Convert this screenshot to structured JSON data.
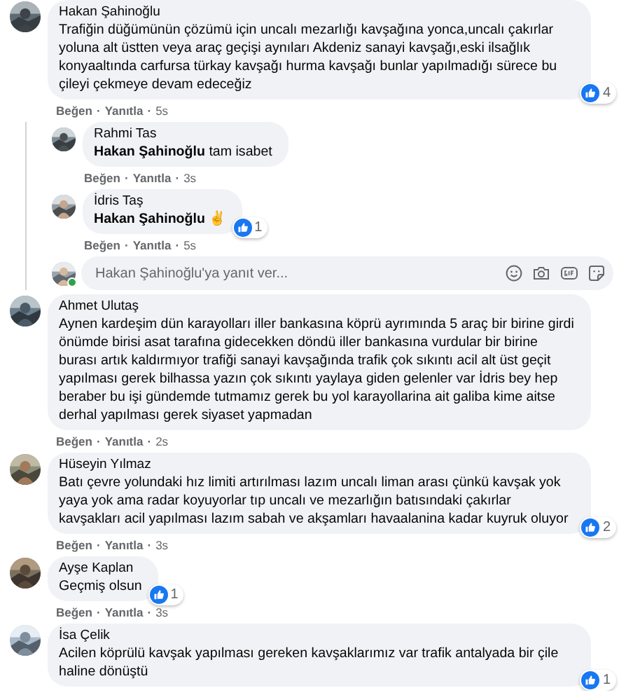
{
  "separator": "·",
  "comments": [
    {
      "author": "Hakan Şahinoğlu",
      "text": "Trafiğin düğümünün çözümü için uncalı mezarlığı kavşağına yonca,uncalı çakırlar yoluna alt üstten veya araç geçişi aynıları Akdeniz sanayi kavşağı,eski ilsağlık konyaaltında carfursa türkay kavşağı hurma kavşağı bunlar yapılmadığı sürece bu çileyi çekmeye devam edeceğiz",
      "likes": "4",
      "like_action": "Beğen",
      "reply_action": "Yanıtla",
      "time": "5s",
      "replies": [
        {
          "author": "Rahmi Tas",
          "text": "**Hakan Şahinoğlu** tam isabet",
          "like_action": "Beğen",
          "reply_action": "Yanıtla",
          "time": "3s"
        },
        {
          "author": "İdris Taş",
          "text": "**Hakan Şahinoğlu** ✌",
          "likes": "1",
          "like_action": "Beğen",
          "reply_action": "Yanıtla",
          "time": "5s"
        }
      ],
      "reply_box": {
        "placeholder": "Hakan Şahinoğlu'ya yanıt ver...",
        "online": true
      }
    },
    {
      "author": "Ahmet Ulutaş",
      "text": "Aynen kardeşim dün karayolları iller bankasına köprü ayrımında 5 araç bir birine girdi önümde birisi asat tarafına gidecekken döndü iller bankasına vurdular bir birine burası artık kaldırmıyor trafiği sanayi kavşağında trafik çok sıkıntı acil alt üst geçit yapılması gerek bilhassa yazın çok sıkıntı yaylaya giden gelenler var İdris bey hep beraber bu işi gündemde tutmamız gerek bu yol karayollarina ait galiba kime aitse derhal yapılması gerek siyaset yapmadan",
      "like_action": "Beğen",
      "reply_action": "Yanıtla",
      "time": "2s"
    },
    {
      "author": "Hüseyin Yılmaz",
      "text": "Batı çevre yolundaki hız limiti artırılması lazım uncalı liman arası çünkü kavşak yok yaya yok ama radar koyuyorlar tıp uncalı ve mezarlığın batısındaki çakırlar kavşakları acil yapılması lazım sabah ve akşamları havaalanina kadar kuyruk oluyor",
      "likes": "2",
      "like_action": "Beğen",
      "reply_action": "Yanıtla",
      "time": "3s"
    },
    {
      "author": "Ayşe Kaplan",
      "text": "Geçmiş olsun",
      "likes": "1",
      "like_action": "Beğen",
      "reply_action": "Yanıtla",
      "time": "3s"
    },
    {
      "author": "İsa Çelik",
      "text": "Acilen köprülü kavşak yapılması gereken kavşaklarımız var trafik antalyada bir çile haline dönüştü",
      "likes": "1"
    }
  ]
}
